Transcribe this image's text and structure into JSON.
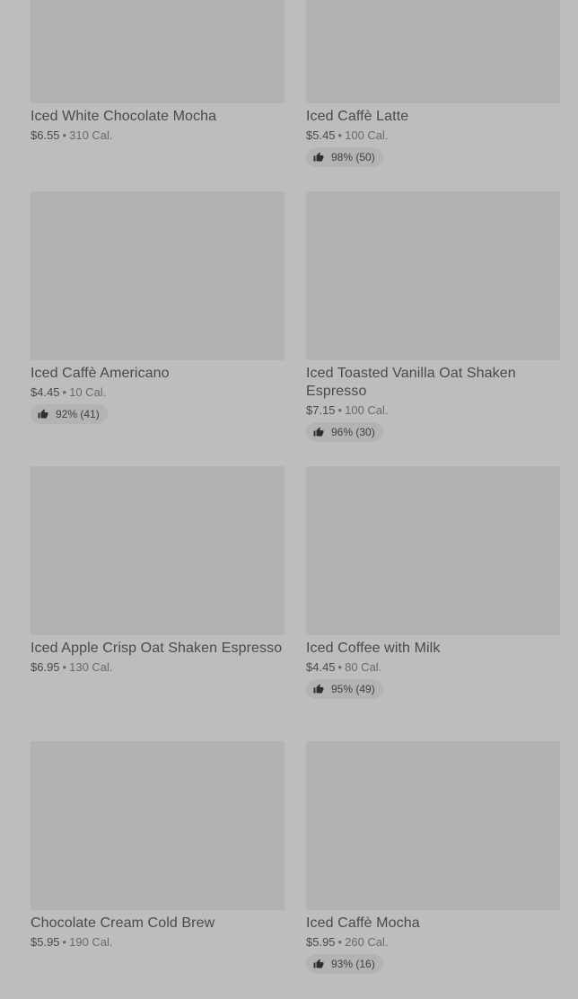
{
  "products": [
    {
      "name": "Iced White Chocolate Mocha",
      "price": "$6.55",
      "calories": "310 Cal.",
      "rating": ""
    },
    {
      "name": "Iced Caffè Latte",
      "price": "$5.45",
      "calories": "100 Cal.",
      "rating": "98% (50)"
    },
    {
      "name": "Iced Caffè Americano",
      "price": "$4.45",
      "calories": "10 Cal.",
      "rating": "92% (41)"
    },
    {
      "name": "Iced Toasted Vanilla Oat Shaken Espresso",
      "price": "$7.15",
      "calories": "100 Cal.",
      "rating": "96% (30)"
    },
    {
      "name": "Iced Apple Crisp Oat Shaken Espresso",
      "price": "$6.95",
      "calories": "130 Cal.",
      "rating": ""
    },
    {
      "name": "Iced Coffee with Milk",
      "price": "$4.45",
      "calories": "80 Cal.",
      "rating": "95% (49)"
    },
    {
      "name": "Chocolate Cream Cold Brew",
      "price": "$5.95",
      "calories": "190 Cal.",
      "rating": ""
    },
    {
      "name": "Iced Caffè Mocha",
      "price": "$5.95",
      "calories": "260 Cal.",
      "rating": "93% (16)"
    }
  ],
  "separator": "•",
  "icons": {
    "rating": "thumbs-up-icon"
  },
  "colors": {
    "overlay": "#bdbdbd",
    "image_placeholder": "#b2b2b2",
    "text": "#4a4a4a"
  }
}
